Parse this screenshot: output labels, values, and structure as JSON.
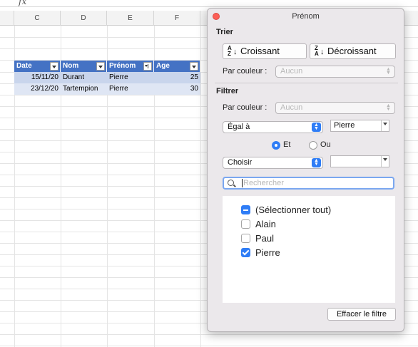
{
  "formula_bar": {
    "fx_label": "fx"
  },
  "columns": [
    "C",
    "D",
    "E",
    "F"
  ],
  "table": {
    "headers": [
      "Date",
      "Nom",
      "Prénom",
      "Age"
    ],
    "rows": [
      [
        "15/11/20",
        "Durant",
        "Pierre",
        "25"
      ],
      [
        "23/12/20",
        "Tartempion",
        "Pierre",
        "30"
      ]
    ],
    "header_color": "#4472c4",
    "row_color": "#c9d5ec"
  },
  "panel": {
    "title": "Prénom",
    "sort": {
      "section_title": "Trier",
      "asc_label": "Croissant",
      "desc_label": "Décroissant",
      "icon_top_asc": "A",
      "icon_bot_asc": "Z",
      "icon_top_desc": "Z",
      "icon_bot_desc": "A",
      "by_color_label": "Par couleur :",
      "by_color_value": "Aucun"
    },
    "filter": {
      "section_title": "Filtrer",
      "by_color_label": "Par couleur :",
      "by_color_value": "Aucun",
      "condition1": "Égal à",
      "value1": "Pierre",
      "and_label": "Et",
      "or_label": "Ou",
      "logic_selected": "Et",
      "condition2": "Choisir",
      "value2": ""
    },
    "search_placeholder": "Rechercher",
    "items": [
      {
        "label": "(Sélectionner tout)",
        "state": "mixed"
      },
      {
        "label": "Alain",
        "state": "off"
      },
      {
        "label": "Paul",
        "state": "off"
      },
      {
        "label": "Pierre",
        "state": "on"
      }
    ],
    "clear_label": "Effacer le filtre"
  },
  "colors": {
    "accent": "#2f7df6",
    "close": "#fc5f57"
  }
}
